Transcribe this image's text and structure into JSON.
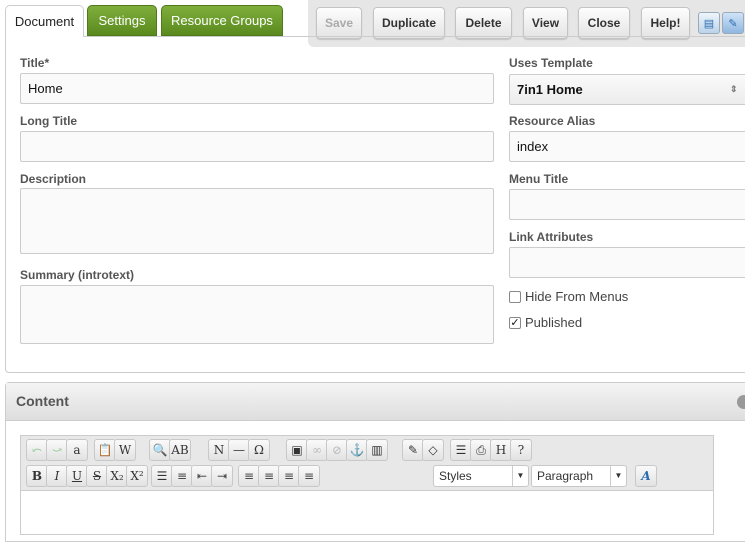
{
  "tabs": [
    {
      "label": "Document",
      "active": true
    },
    {
      "label": "Settings"
    },
    {
      "label": "Resource Groups"
    }
  ],
  "toolbar": {
    "save": "Save",
    "duplicate": "Duplicate",
    "delete": "Delete",
    "view": "View",
    "close": "Close",
    "help": "Help!",
    "icons": [
      "new-resource-icon",
      "edit-resource-icon"
    ]
  },
  "form": {
    "title": {
      "label": "Title*",
      "value": "Home"
    },
    "long_title": {
      "label": "Long Title",
      "value": ""
    },
    "description": {
      "label": "Description",
      "value": ""
    },
    "summary": {
      "label": "Summary (introtext)",
      "value": ""
    },
    "template": {
      "label": "Uses Template",
      "value": "7in1 Home"
    },
    "alias": {
      "label": "Resource Alias",
      "value": "index"
    },
    "menu_title": {
      "label": "Menu Title",
      "value": ""
    },
    "link_attributes": {
      "label": "Link Attributes",
      "value": ""
    },
    "hide_from_menus": {
      "label": "Hide From Menus",
      "checked": false
    },
    "published": {
      "label": "Published",
      "checked": true
    }
  },
  "content": {
    "title": "Content",
    "row1": [
      [
        "undo",
        "⤺"
      ],
      [
        "redo",
        "⤻"
      ],
      [
        "select-all",
        "a"
      ],
      [
        "paste",
        "📋"
      ],
      [
        "paste-word",
        "W"
      ],
      [
        "find",
        "🔍"
      ],
      [
        "replace",
        "AB"
      ],
      [
        "cleanup",
        "N"
      ],
      [
        "hr",
        "—"
      ],
      [
        "charmap",
        "Ω"
      ],
      [
        "image",
        "▣"
      ],
      [
        "link",
        "∞"
      ],
      [
        "unlink",
        "⊘"
      ],
      [
        "anchor",
        "⚓"
      ],
      [
        "media",
        "▥"
      ],
      [
        "styleprops",
        "✎"
      ],
      [
        "remove-format",
        "◇"
      ],
      [
        "template",
        "☰"
      ],
      [
        "print",
        "⎙"
      ],
      [
        "html",
        "H"
      ],
      [
        "help",
        "?"
      ]
    ],
    "row2": [
      [
        "bold",
        "B"
      ],
      [
        "italic",
        "I"
      ],
      [
        "underline",
        "U"
      ],
      [
        "strikethrough",
        "S"
      ],
      [
        "subscript",
        "X₂"
      ],
      [
        "superscript",
        "X²"
      ],
      [
        "bullet-list",
        "☰"
      ],
      [
        "numbered-list",
        "≡"
      ],
      [
        "outdent",
        "⇤"
      ],
      [
        "indent",
        "⇥"
      ],
      [
        "align-left",
        "≡"
      ],
      [
        "align-center",
        "≡"
      ],
      [
        "align-right",
        "≡"
      ],
      [
        "justify",
        "≡"
      ]
    ],
    "styles": "Styles",
    "format": "Paragraph",
    "forecolor": "A"
  }
}
